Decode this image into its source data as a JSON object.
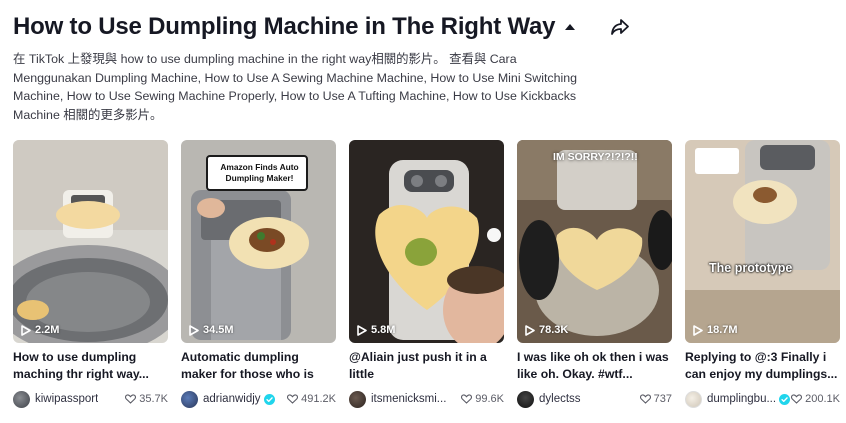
{
  "header": {
    "title": "How to Use Dumpling Machine in The Right Way",
    "caret_icon": "caret-up-icon",
    "share_icon": "share-icon"
  },
  "description": "在 TikTok 上發現與 how to use dumpling machine in the right way相關的影片。 查看與 Cara Menggunakan Dumpling Machine, How to Use A Sewing Machine Machine, How to Use Mini Switching Machine, How to Use Sewing Machine Properly, How to Use A Tufting Machine, How to Use Kickbacks Machine 相關的更多影片。",
  "videos": [
    {
      "views": "2.2M",
      "caption": "How to use dumpling maching thr right way...",
      "author": "kiwipassport",
      "verified": false,
      "likes": "35.7K",
      "overlay": ""
    },
    {
      "views": "34.5M",
      "caption": "Automatic dumpling maker for those who is not good...",
      "author": "adrianwidjy",
      "verified": true,
      "likes": "491.2K",
      "overlay": "Amazon Finds Auto Dumpling Maker!"
    },
    {
      "views": "5.8M",
      "caption": "@Aliain just push it in a little",
      "author": "itsmenicksmi...",
      "verified": false,
      "likes": "99.6K",
      "overlay": ""
    },
    {
      "views": "78.3K",
      "caption": "I was like oh ok then i was like oh. Okay. #wtf...",
      "author": "dylectss",
      "verified": false,
      "likes": "737",
      "overlay": "IM SORRY?!?!?!!"
    },
    {
      "views": "18.7M",
      "caption": "Replying to @:3 Finally i can enjoy my dumplings...",
      "author": "dumplingbu...",
      "verified": true,
      "likes": "200.1K",
      "overlay": "The prototype"
    }
  ],
  "colors": {
    "text": "#161823",
    "verified_badge": "#20d5ec"
  }
}
